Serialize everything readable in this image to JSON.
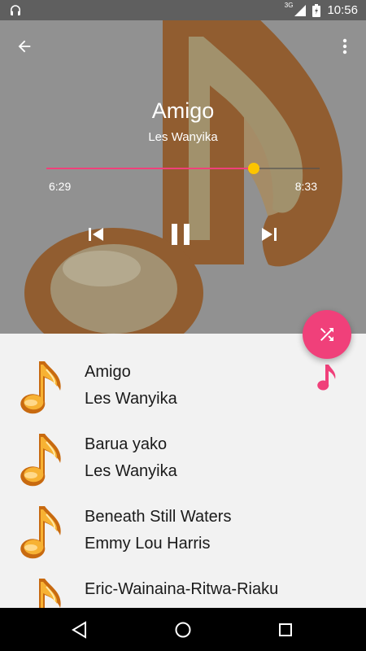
{
  "status_bar": {
    "network_label": "3G",
    "time": "10:56",
    "icons": [
      "headphones-icon",
      "signal-icon",
      "battery-icon"
    ]
  },
  "header": {
    "back_icon": "arrow-back-icon",
    "menu_icon": "more-vert-icon"
  },
  "now_playing": {
    "title": "Amigo",
    "artist": "Les Wanyika",
    "elapsed": "6:29",
    "total": "8:33",
    "progress_fraction": 0.758
  },
  "controls": {
    "prev_icon": "skip-previous-icon",
    "pause_icon": "pause-icon",
    "next_icon": "skip-next-icon",
    "shuffle_icon": "shuffle-icon"
  },
  "songs": [
    {
      "title": "Amigo",
      "artist": "Les Wanyika",
      "playing": true
    },
    {
      "title": "Barua yako",
      "artist": "Les Wanyika"
    },
    {
      "title": "Beneath Still Waters",
      "artist": "Emmy Lou Harris"
    },
    {
      "title": "Eric-Wainaina-Ritwa-Riaku",
      "artist": ""
    }
  ],
  "colors": {
    "accent": "#f0407a",
    "thumb": "#fcc500",
    "note_orange": "#f5a623"
  }
}
